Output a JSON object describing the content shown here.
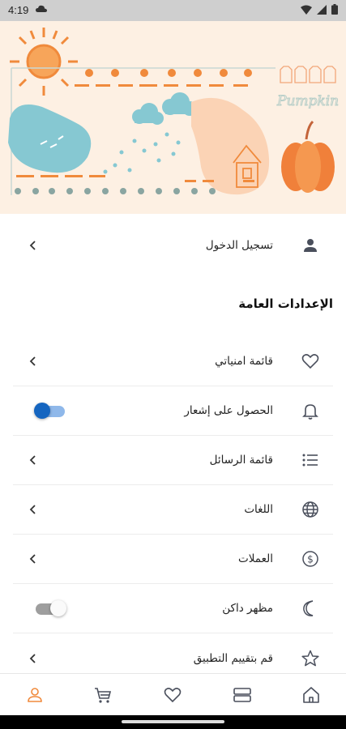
{
  "status_bar": {
    "time": "4:19"
  },
  "banner": {
    "pumpkin_text": "Pumpkin"
  },
  "login": {
    "label": "تسجيل الدخول"
  },
  "section": {
    "title": "الإعدادات العامة"
  },
  "settings": [
    {
      "label": "قائمة امنياتي",
      "icon": "heart-icon",
      "control": "chevron"
    },
    {
      "label": "الحصول على إشعار",
      "icon": "bell-icon",
      "control": "toggle",
      "toggle_on": true
    },
    {
      "label": "قائمة الرسائل",
      "icon": "list-icon",
      "control": "chevron"
    },
    {
      "label": "اللغات",
      "icon": "globe-icon",
      "control": "chevron"
    },
    {
      "label": "العملات",
      "icon": "dollar-icon",
      "control": "chevron"
    },
    {
      "label": "مظهر داكن",
      "icon": "moon-icon",
      "control": "toggle",
      "toggle_on": false
    },
    {
      "label": "قم بتقييم التطبيق",
      "icon": "star-icon",
      "control": "chevron"
    }
  ],
  "bottom_nav": [
    "account-icon",
    "cart-icon",
    "heart-icon",
    "categories-icon",
    "home-icon"
  ],
  "colors": {
    "accent": "#f08a3c",
    "toggle_on": "#1565c0",
    "icon": "#4a4f5c"
  }
}
